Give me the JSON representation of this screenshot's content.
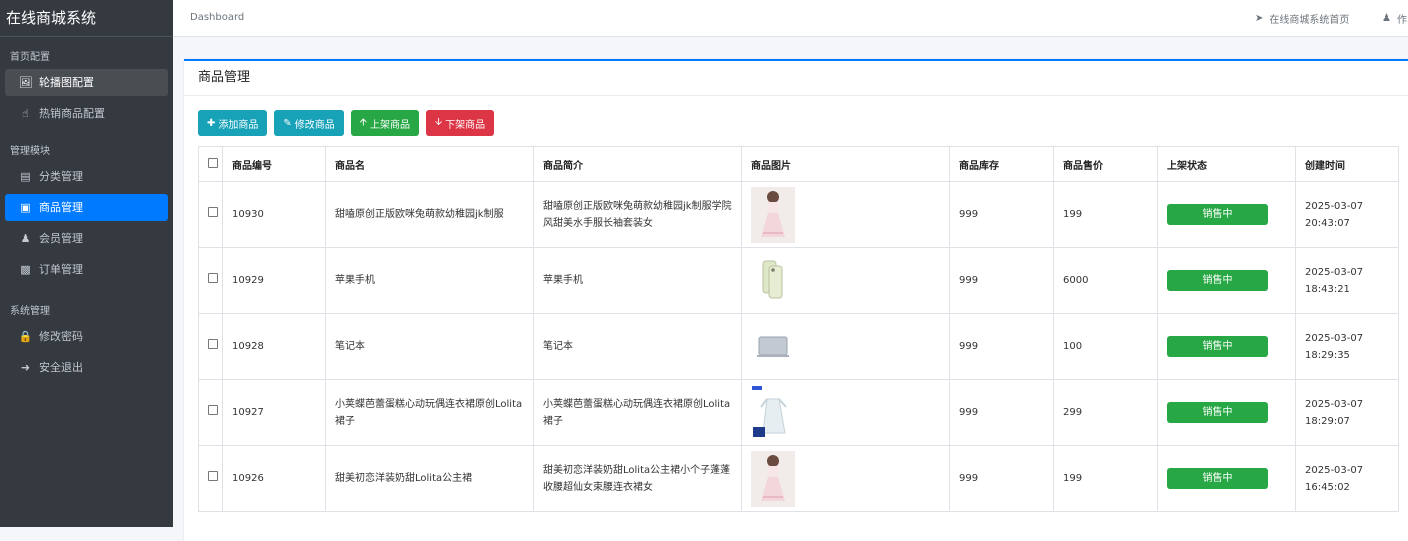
{
  "app_title": "在线商城系统",
  "sidebar": {
    "sections": [
      {
        "title": "首页配置",
        "items": [
          {
            "label": "轮播图配置",
            "icon": "image-icon",
            "state": "hover"
          },
          {
            "label": "热销商品配置",
            "icon": "hand-pointer-icon",
            "state": ""
          }
        ]
      },
      {
        "title": "管理模块",
        "items": [
          {
            "label": "分类管理",
            "icon": "list-icon",
            "state": ""
          },
          {
            "label": "商品管理",
            "icon": "inbox-icon",
            "state": "active"
          },
          {
            "label": "会员管理",
            "icon": "users-icon",
            "state": ""
          },
          {
            "label": "订单管理",
            "icon": "money-icon",
            "state": ""
          }
        ]
      },
      {
        "title": "系统管理",
        "items": [
          {
            "label": "修改密码",
            "icon": "lock-icon",
            "state": ""
          },
          {
            "label": "安全退出",
            "icon": "sign-out-icon",
            "state": ""
          }
        ]
      }
    ]
  },
  "topbar": {
    "breadcrumb": "Dashboard",
    "home_link": "在线商城系统首页",
    "user_link": "作"
  },
  "panel": {
    "title": "商品管理"
  },
  "toolbar": {
    "add": "添加商品",
    "edit": "修改商品",
    "shelf_up": "上架商品",
    "shelf_down": "下架商品"
  },
  "table": {
    "headers": [
      "商品编号",
      "商品名",
      "商品简介",
      "商品图片",
      "商品库存",
      "商品售价",
      "上架状态",
      "创建时间"
    ],
    "rows": [
      {
        "id": "10930",
        "name": "甜嗑原创正版欧咪兔萌款幼稚园jk制服",
        "intro": "甜嗑原创正版欧咪兔萌款幼稚园jk制服学院风甜美水手服长袖套装女",
        "image": "dress-pink",
        "stock": "999",
        "price": "199",
        "status": "销售中",
        "created": "2025-03-07 20:43:07"
      },
      {
        "id": "10929",
        "name": "苹果手机",
        "intro": "苹果手机",
        "image": "phone",
        "stock": "999",
        "price": "6000",
        "status": "销售中",
        "created": "2025-03-07 18:43:21"
      },
      {
        "id": "10928",
        "name": "笔记本",
        "intro": "笔记本",
        "image": "laptop",
        "stock": "999",
        "price": "100",
        "status": "销售中",
        "created": "2025-03-07 18:29:35"
      },
      {
        "id": "10927",
        "name": "小荚蝶芭蕾蛋糕心动玩偶连衣裙原创Lolita裙子",
        "intro": "小荚蝶芭蕾蛋糕心动玩偶连衣裙原创Lolita裙子",
        "image": "dress-white",
        "stock": "999",
        "price": "299",
        "status": "销售中",
        "created": "2025-03-07 18:29:07"
      },
      {
        "id": "10926",
        "name": "甜美初恋洋装奶甜Lolita公主裙",
        "intro": "甜美初恋洋装奶甜Lolita公主裙小个子蓬蓬收腰超仙女束腰连衣裙女",
        "image": "dress-pink",
        "stock": "999",
        "price": "199",
        "status": "销售中",
        "created": "2025-03-07 16:45:02"
      }
    ]
  },
  "colors": {
    "sidebar_bg": "#343a40",
    "active": "#007bff",
    "status": "#28a745",
    "info": "#17a2b8",
    "danger": "#dc3545"
  }
}
